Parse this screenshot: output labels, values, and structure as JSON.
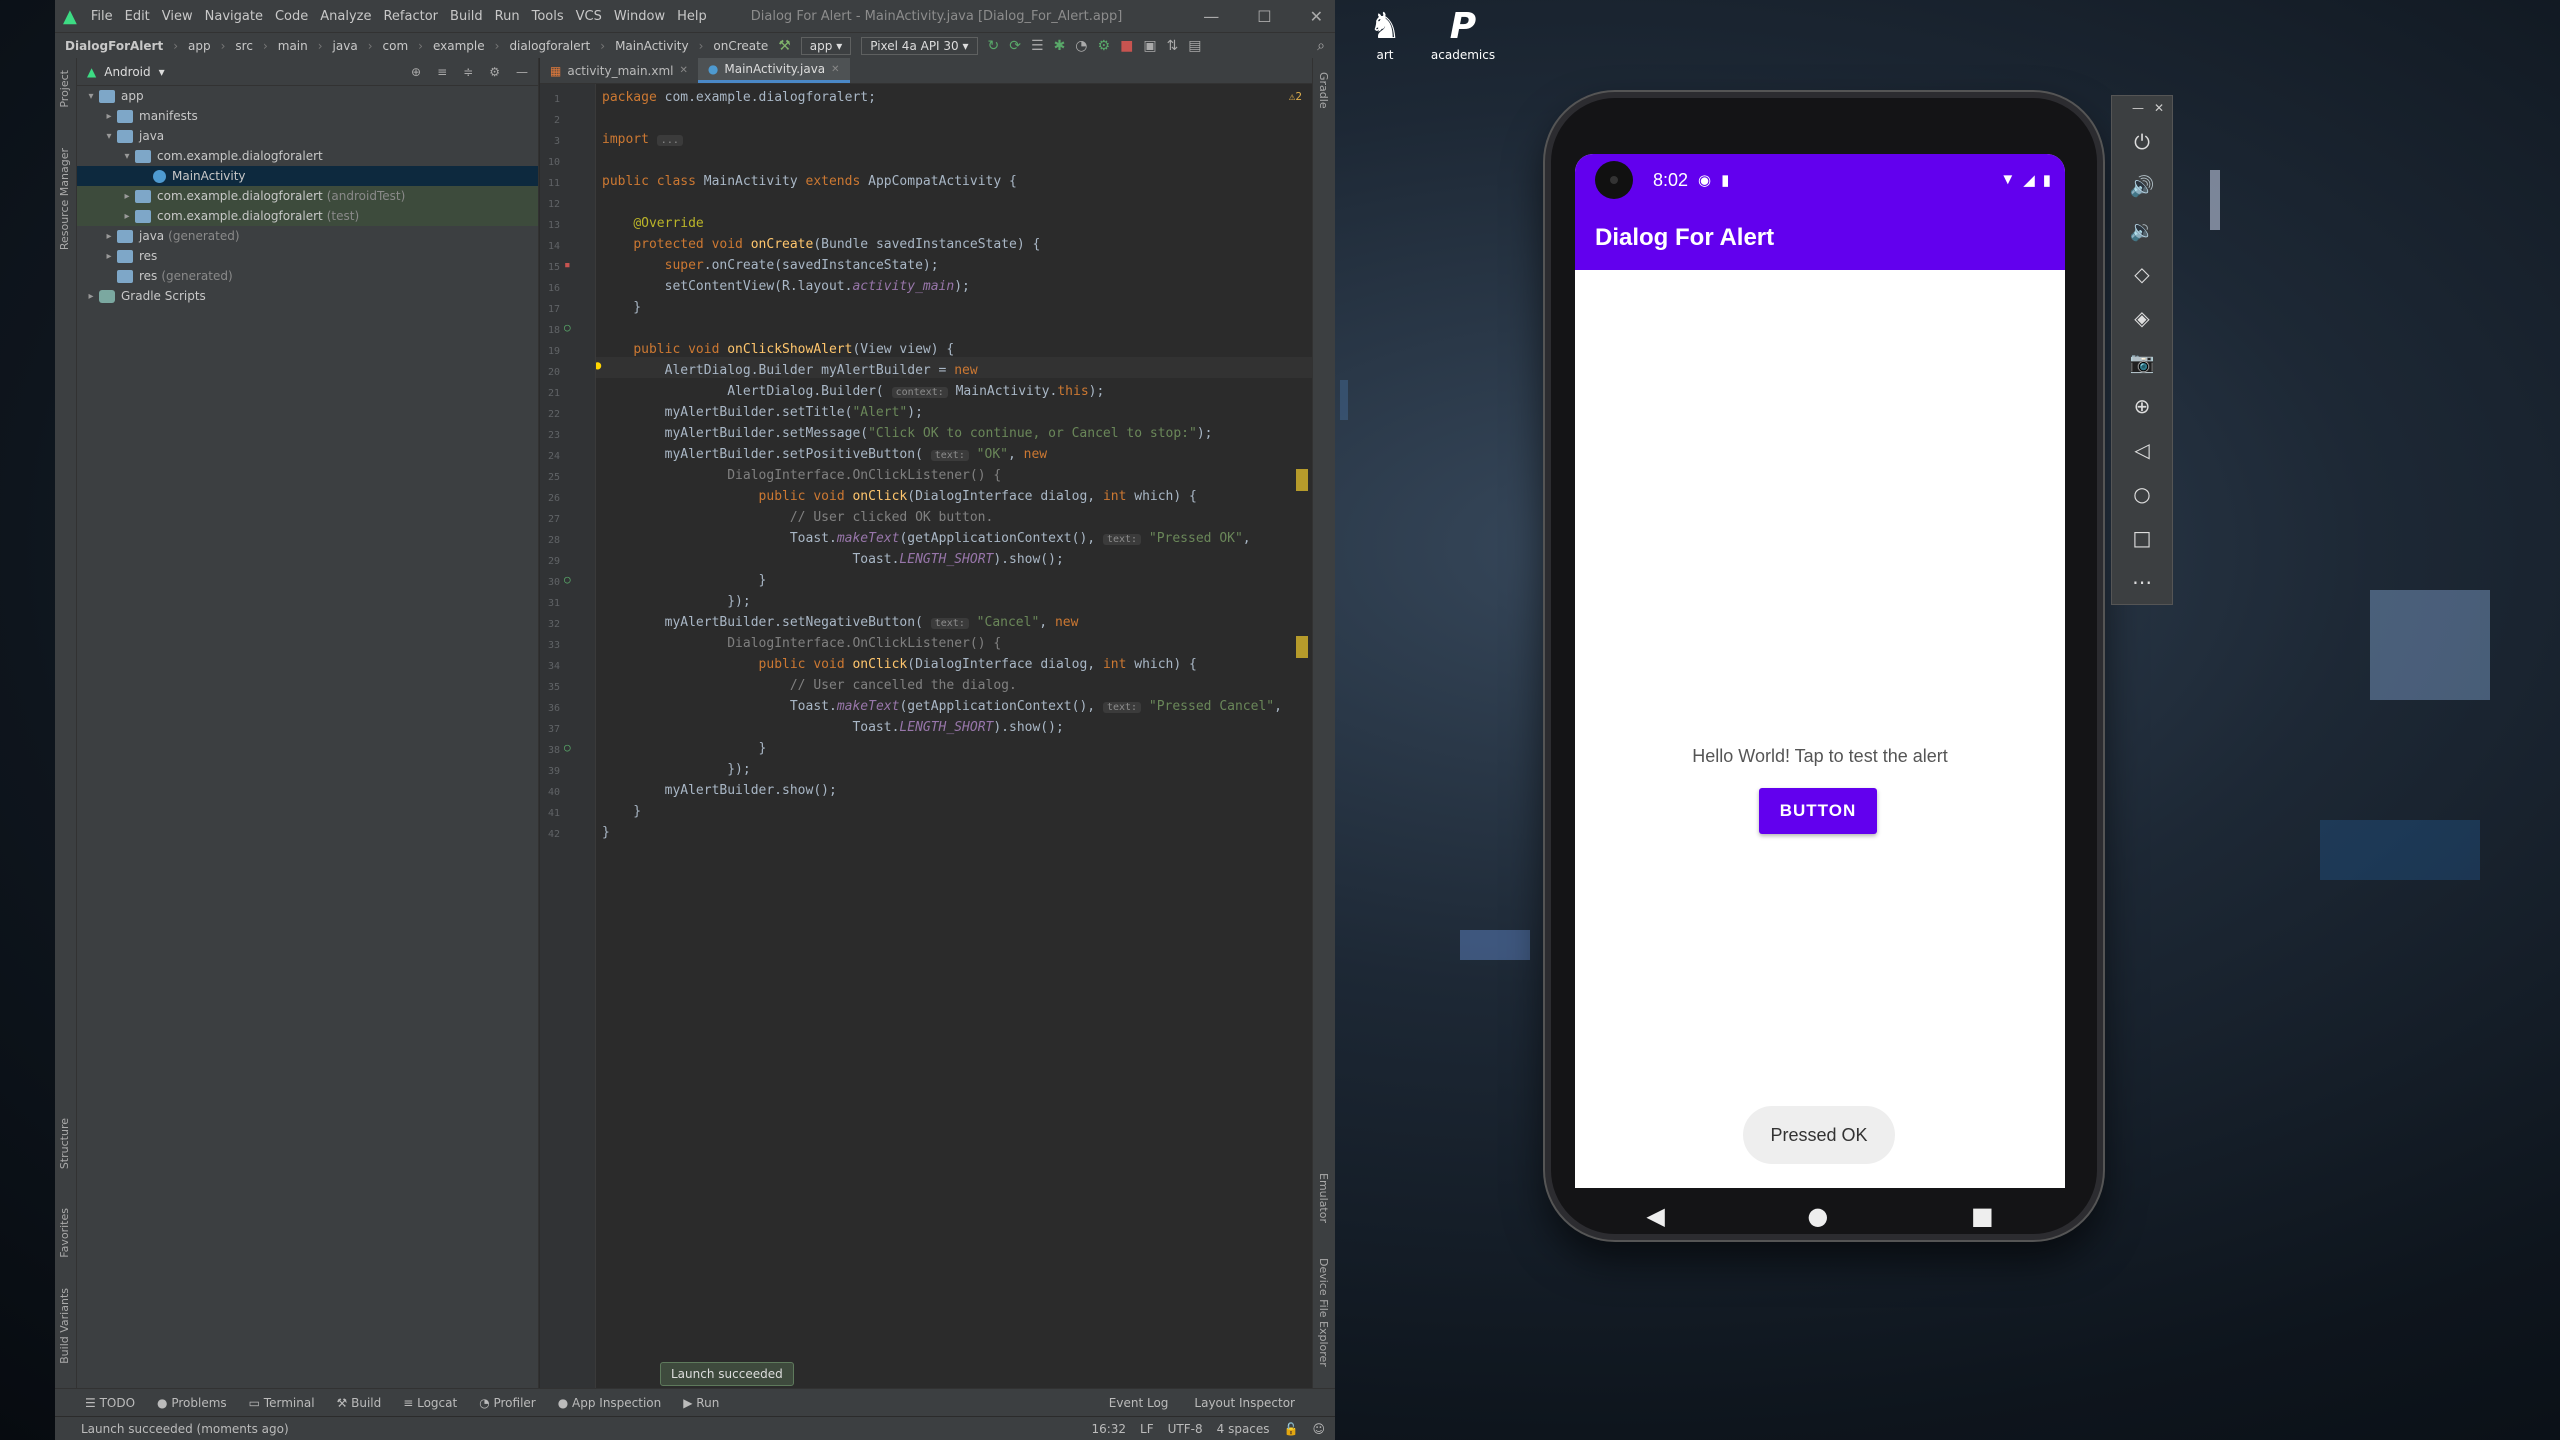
{
  "desktop": {
    "icons": [
      {
        "label": "art",
        "glyph": "♞"
      },
      {
        "label": "academics",
        "glyph": "P"
      }
    ]
  },
  "ide": {
    "menu": [
      "File",
      "Edit",
      "View",
      "Navigate",
      "Code",
      "Analyze",
      "Refactor",
      "Build",
      "Run",
      "Tools",
      "VCS",
      "Window",
      "Help"
    ],
    "window_title": "Dialog For Alert - MainActivity.java [Dialog_For_Alert.app]",
    "breadcrumbs": [
      "DialogForAlert",
      "app",
      "src",
      "main",
      "java",
      "com",
      "example",
      "dialogforalert",
      "MainActivity",
      "onCreate"
    ],
    "run_config": "app",
    "device": "Pixel 4a API 30",
    "project_view": "Android",
    "tree": [
      {
        "label": "app",
        "hint": "",
        "depth": 0,
        "arrow": "v",
        "icon": "folder"
      },
      {
        "label": "manifests",
        "hint": "",
        "depth": 1,
        "arrow": ">",
        "icon": "folder"
      },
      {
        "label": "java",
        "hint": "",
        "depth": 1,
        "arrow": "v",
        "icon": "folder"
      },
      {
        "label": "com.example.dialogforalert",
        "hint": "",
        "depth": 2,
        "arrow": "v",
        "icon": "folder"
      },
      {
        "label": "MainActivity",
        "hint": "",
        "depth": 3,
        "arrow": "",
        "icon": "cls"
      },
      {
        "label": "com.example.dialogforalert",
        "hint": "(androidTest)",
        "depth": 2,
        "arrow": ">",
        "icon": "folder"
      },
      {
        "label": "com.example.dialogforalert",
        "hint": "(test)",
        "depth": 2,
        "arrow": ">",
        "icon": "folder"
      },
      {
        "label": "java",
        "hint": "(generated)",
        "depth": 1,
        "arrow": ">",
        "icon": "folder"
      },
      {
        "label": "res",
        "hint": "",
        "depth": 1,
        "arrow": ">",
        "icon": "folder"
      },
      {
        "label": "res",
        "hint": "(generated)",
        "depth": 1,
        "arrow": "",
        "icon": "folder"
      },
      {
        "label": "Gradle Scripts",
        "hint": "",
        "depth": 0,
        "arrow": ">",
        "icon": "gradle"
      }
    ],
    "tabs": [
      "activity_main.xml",
      "MainActivity.java"
    ],
    "warnings": "⚠2",
    "line_numbers": [
      "1",
      "2",
      "3",
      "10",
      "11",
      "12",
      "13",
      "14",
      "15",
      "16",
      "17",
      "18",
      "19",
      "20",
      "21",
      "22",
      "23",
      "24",
      "25",
      "26",
      "27",
      "28",
      "29",
      "30",
      "31",
      "32",
      "33",
      "34",
      "35",
      "36",
      "37",
      "38",
      "39",
      "40",
      "41",
      "42"
    ],
    "code_lines": [
      "<span class='kw'>package</span> com.example.dialogforalert;",
      "",
      "<span class='kw'>import</span> <span class='hintb'>...</span>",
      "",
      "<span class='kw'>public class</span> MainActivity <span class='kw'>extends</span> AppCompatActivity {",
      "",
      "    <span class='ann'>@Override</span>",
      "    <span class='kw'>protected void</span> <span class='fn'>onCreate</span>(Bundle savedInstanceState) {",
      "        <span class='kw'>super</span>.onCreate(savedInstanceState);",
      "        setContentView(R.layout.<span class='fld'>activity_main</span>);",
      "    }",
      "",
      "    <span class='kw'>public void</span> <span class='fn'>onClickShowAlert</span>(View view) {",
      "        AlertDialog.Builder myAlertBuilder = <span class='kw'>new</span>",
      "                AlertDialog.Builder( <span class='hintb'>context:</span> MainActivity.<span class='kw'>this</span>);",
      "        myAlertBuilder.setTitle(<span class='str'>\"Alert\"</span>);",
      "        myAlertBuilder.setMessage(<span class='str'>\"Click OK to continue, or Cancel to stop:\"</span>);",
      "        myAlertBuilder.setPositiveButton( <span class='hintb'>text:</span> <span class='str'>\"OK\"</span>, <span class='kw'>new</span>",
      "                <span class='cmt'>DialogInterface.OnClickListener() {</span>",
      "                    <span class='kw'>public void</span> <span class='fn'>onClick</span>(DialogInterface dialog, <span class='kw'>int</span> which) {",
      "                        <span class='cmt'>// User clicked OK button.</span>",
      "                        Toast.<span class='fld'>makeText</span>(getApplicationContext(), <span class='hintb'>text:</span> <span class='str'>\"Pressed OK\"</span>,",
      "                                Toast.<span class='fld'>LENGTH_SHORT</span>).show();",
      "                    }",
      "                });",
      "        myAlertBuilder.setNegativeButton( <span class='hintb'>text:</span> <span class='str'>\"Cancel\"</span>, <span class='kw'>new</span>",
      "                <span class='cmt'>DialogInterface.OnClickListener() {</span>",
      "                    <span class='kw'>public void</span> <span class='fn'>onClick</span>(DialogInterface dialog, <span class='kw'>int</span> which) {",
      "                        <span class='cmt'>// User cancelled the dialog.</span>",
      "                        Toast.<span class='fld'>makeText</span>(getApplicationContext(), <span class='hintb'>text:</span> <span class='str'>\"Pressed Cancel\"</span>,",
      "                                Toast.<span class='fld'>LENGTH_SHORT</span>).show();",
      "                    }",
      "                });",
      "        myAlertBuilder.show();",
      "    }",
      "}"
    ],
    "left_tabs": [
      "Project",
      "Resource Manager",
      "Structure",
      "Favorites",
      "Build Variants"
    ],
    "right_tabs": [
      "Gradle",
      "Emulator",
      "Device File Explorer"
    ],
    "bottom_tools": [
      "TODO",
      "Problems",
      "Terminal",
      "Build",
      "Logcat",
      "Profiler",
      "App Inspection",
      "Run"
    ],
    "bottom_tools_right": [
      "Event Log",
      "Layout Inspector"
    ],
    "launch_toast": "Launch succeeded",
    "status_text": "Launch succeeded (moments ago)",
    "status_right": [
      "16:32",
      "LF",
      "UTF-8",
      "4 spaces"
    ]
  },
  "phone": {
    "time": "8:02",
    "app_title": "Dialog For Alert",
    "hello": "Hello World! Tap to test the alert",
    "button": "BUTTON",
    "toast": "Pressed OK",
    "primary_color": "#6200ee"
  },
  "emulator_panel": {
    "buttons": [
      "power-icon",
      "volume-up-icon",
      "volume-down-icon",
      "rotate-left-icon",
      "rotate-right-icon",
      "camera-icon",
      "zoom-icon",
      "back-icon",
      "home-icon",
      "overview-icon",
      "more-icon"
    ]
  }
}
